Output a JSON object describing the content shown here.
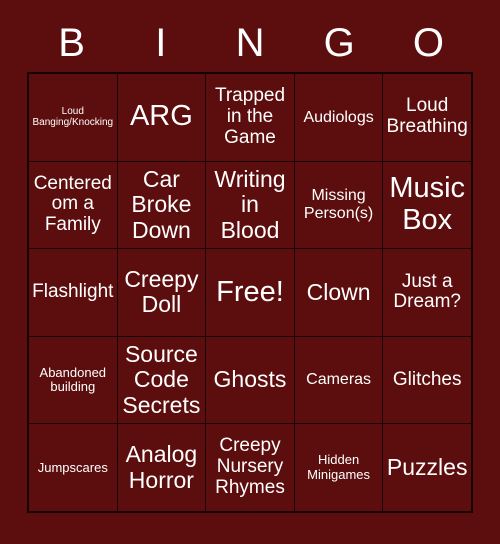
{
  "header": {
    "letters": [
      "B",
      "I",
      "N",
      "G",
      "O"
    ]
  },
  "colors": {
    "background": "#5c0d0d",
    "cell_fill": "#5c0d0d",
    "grid_line": "#170303",
    "text": "#ffffff"
  },
  "grid": {
    "rows": 5,
    "columns": 5,
    "cells": [
      {
        "text": "Loud Banging/Knocking",
        "size": "sz-xs"
      },
      {
        "text": "ARG",
        "size": "sz-xxl"
      },
      {
        "text": "Trapped in the Game",
        "size": "sz-l"
      },
      {
        "text": "Audiologs",
        "size": "sz-m"
      },
      {
        "text": "Loud Breathing",
        "size": "sz-l"
      },
      {
        "text": "Centered om a Family",
        "size": "sz-l"
      },
      {
        "text": "Car Broke Down",
        "size": "sz-xl"
      },
      {
        "text": "Writing in Blood",
        "size": "sz-xl"
      },
      {
        "text": "Missing Person(s)",
        "size": "sz-m"
      },
      {
        "text": "Music Box",
        "size": "sz-xxl"
      },
      {
        "text": "Flashlight",
        "size": "sz-l"
      },
      {
        "text": "Creepy Doll",
        "size": "sz-xl"
      },
      {
        "text": "Free!",
        "size": "sz-xxl"
      },
      {
        "text": "Clown",
        "size": "sz-xl"
      },
      {
        "text": "Just a Dream?",
        "size": "sz-l"
      },
      {
        "text": "Abandoned building",
        "size": "sz-s"
      },
      {
        "text": "Source Code Secrets",
        "size": "sz-xl"
      },
      {
        "text": "Ghosts",
        "size": "sz-xl"
      },
      {
        "text": "Cameras",
        "size": "sz-m"
      },
      {
        "text": "Glitches",
        "size": "sz-l"
      },
      {
        "text": "Jumpscares",
        "size": "sz-s"
      },
      {
        "text": "Analog Horror",
        "size": "sz-xl"
      },
      {
        "text": "Creepy Nursery Rhymes",
        "size": "sz-l"
      },
      {
        "text": "Hidden Minigames",
        "size": "sz-s"
      },
      {
        "text": "Puzzles",
        "size": "sz-xl"
      }
    ]
  }
}
